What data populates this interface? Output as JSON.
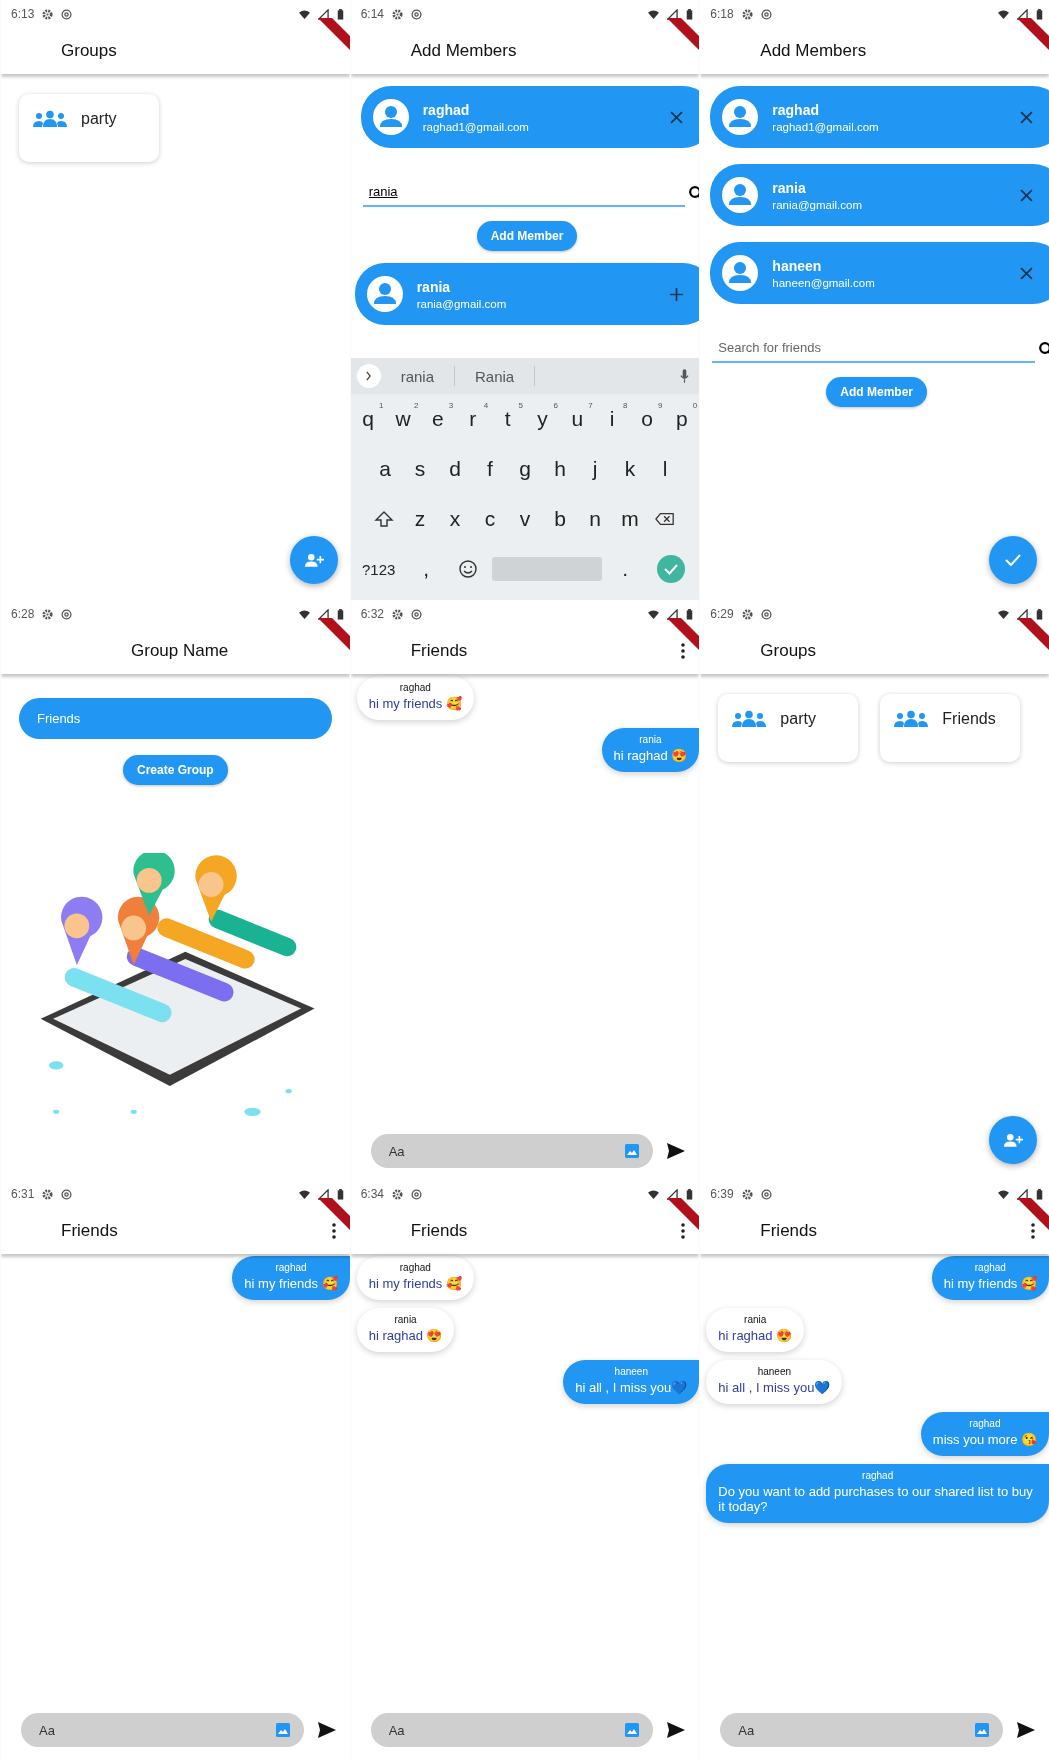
{
  "screens": [
    {
      "kind": "groups",
      "time": "6:13",
      "title": "Groups",
      "groups": [
        {
          "name": "party"
        }
      ],
      "fab": {
        "kind": "add_person"
      }
    },
    {
      "kind": "add_members",
      "time": "6:14",
      "title": "Add Members",
      "members": [
        {
          "name": "raghad",
          "email": "raghad1@gmail.com",
          "kind": "remove"
        }
      ],
      "search": {
        "value": "rania"
      },
      "button": "Add Member",
      "results": [
        {
          "name": "rania",
          "email": "rania@gmail.com",
          "kind": "add"
        }
      ],
      "keyboard": {
        "suggestions": [
          "rania",
          "Rania"
        ],
        "rows": [
          [
            {
              "key": "q",
              "hint": "1"
            },
            {
              "key": "w",
              "hint": "2"
            },
            {
              "key": "e",
              "hint": "3"
            },
            {
              "key": "r",
              "hint": "4"
            },
            {
              "key": "t",
              "hint": "5"
            },
            {
              "key": "y",
              "hint": "6"
            },
            {
              "key": "u",
              "hint": "7"
            },
            {
              "key": "i",
              "hint": "8"
            },
            {
              "key": "o",
              "hint": "9"
            },
            {
              "key": "p",
              "hint": "0"
            }
          ],
          [
            {
              "key": "a"
            },
            {
              "key": "s"
            },
            {
              "key": "d"
            },
            {
              "key": "f"
            },
            {
              "key": "g"
            },
            {
              "key": "h"
            },
            {
              "key": "j"
            },
            {
              "key": "k"
            },
            {
              "key": "l"
            }
          ],
          [
            {
              "key": "z"
            },
            {
              "key": "x"
            },
            {
              "key": "c"
            },
            {
              "key": "v"
            },
            {
              "key": "b"
            },
            {
              "key": "n"
            },
            {
              "key": "m"
            }
          ]
        ],
        "symbols": "?123",
        "comma": ",",
        "period": "."
      }
    },
    {
      "kind": "add_members",
      "time": "6:18",
      "title": "Add Members",
      "members": [
        {
          "name": "raghad",
          "email": "raghad1@gmail.com",
          "kind": "remove"
        },
        {
          "name": "rania",
          "email": "rania@gmail.com",
          "kind": "remove"
        },
        {
          "name": "haneen",
          "email": "haneen@gmail.com",
          "kind": "remove"
        }
      ],
      "search": {
        "placeholder": "Search for friends"
      },
      "button": "Add Member",
      "fab": {
        "kind": "check"
      }
    },
    {
      "kind": "group_name",
      "time": "6:28",
      "title": "Group Name",
      "field": "Friends",
      "button": "Create Group"
    },
    {
      "kind": "chat",
      "time": "6:32",
      "title": "Friends",
      "messages": [
        {
          "sender": "raghad",
          "text": "hi my friends 🥰",
          "sent": false
        },
        {
          "sender": "rania",
          "text": "hi raghad 😍",
          "sent": true
        }
      ],
      "input": {
        "placeholder": "Aa"
      }
    },
    {
      "kind": "groups",
      "time": "6:29",
      "title": "Groups",
      "groups": [
        {
          "name": "party"
        },
        {
          "name": "Friends"
        }
      ],
      "fab": {
        "kind": "add_person"
      }
    },
    {
      "kind": "chat",
      "time": "6:31",
      "title": "Friends",
      "messages": [
        {
          "sender": "raghad",
          "text": "hi my friends 🥰",
          "sent": true
        }
      ],
      "input": {
        "placeholder": "Aa"
      }
    },
    {
      "kind": "chat",
      "time": "6:34",
      "title": "Friends",
      "messages": [
        {
          "sender": "raghad",
          "text": "hi my friends 🥰",
          "sent": false
        },
        {
          "sender": "rania",
          "text": "hi raghad 😍",
          "sent": false
        },
        {
          "sender": "haneen",
          "text": "hi all , I miss you💙",
          "sent": true
        }
      ],
      "input": {
        "placeholder": "Aa"
      }
    },
    {
      "kind": "chat",
      "time": "6:39",
      "title": "Friends",
      "messages": [
        {
          "sender": "raghad",
          "text": "hi my friends 🥰",
          "sent": true
        },
        {
          "sender": "rania",
          "text": "hi raghad 😍",
          "sent": false
        },
        {
          "sender": "haneen",
          "text": "hi all , I miss you💙",
          "sent": false
        },
        {
          "sender": "raghad",
          "text": "miss you more 😘",
          "sent": true
        },
        {
          "sender": "raghad",
          "text": "Do you want to add purchases to our shared list to buy it today?",
          "sent": true
        }
      ],
      "input": {
        "placeholder": "Aa"
      }
    }
  ]
}
